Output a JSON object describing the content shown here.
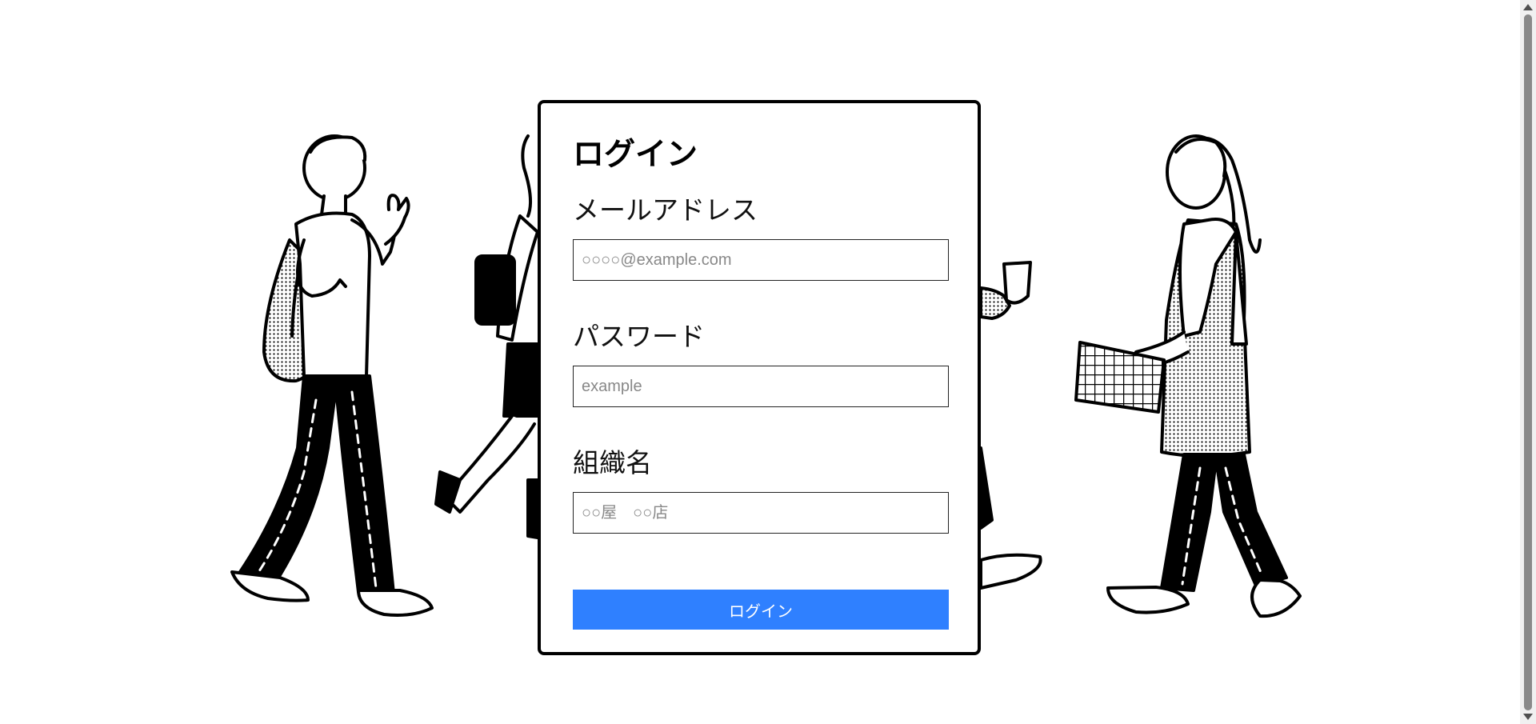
{
  "login_card": {
    "title": "ログイン",
    "email": {
      "label": "メールアドレス",
      "placeholder": "○○○○@example.com",
      "value": ""
    },
    "password": {
      "label": "パスワード",
      "placeholder": "example",
      "value": ""
    },
    "organization": {
      "label": "組織名",
      "placeholder": "○○屋　○○店",
      "value": ""
    },
    "submit_label": "ログイン"
  },
  "colors": {
    "button": "#2f80ff",
    "card_border": "#000000",
    "background": "#ffffff"
  },
  "icons": {
    "background_illustration": "walking-people-illustration"
  }
}
